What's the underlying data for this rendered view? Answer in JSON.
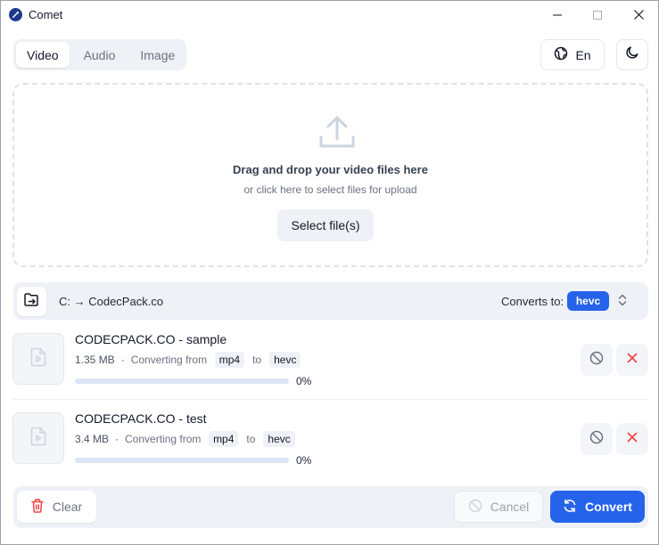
{
  "window": {
    "title": "Comet"
  },
  "tabs": [
    {
      "label": "Video",
      "active": true
    },
    {
      "label": "Audio",
      "active": false
    },
    {
      "label": "Image",
      "active": false
    }
  ],
  "language": {
    "label": "En"
  },
  "dropzone": {
    "title": "Drag and drop your video files here",
    "subtitle": "or click here to select files for upload",
    "select_label": "Select file(s)"
  },
  "output": {
    "path": "C: → CodecPack.co",
    "converts_label": "Converts to:",
    "format": "hevc"
  },
  "files": [
    {
      "name": "CODECPACK.CO - sample",
      "size": "1.35 MB",
      "status": "Converting from",
      "from": "mp4",
      "to_label": "to",
      "to": "hevc",
      "progress": 0,
      "progress_label": "0%"
    },
    {
      "name": "CODECPACK.CO - test",
      "size": "3.4 MB",
      "status": "Converting from",
      "from": "mp4",
      "to_label": "to",
      "to": "hevc",
      "progress": 0,
      "progress_label": "0%"
    }
  ],
  "footer": {
    "clear_label": "Clear",
    "cancel_label": "Cancel",
    "convert_label": "Convert"
  },
  "colors": {
    "accent": "#2563eb",
    "danger": "#ef4444",
    "surface": "#eef1f6"
  },
  "icons": {
    "app": "comet-app-icon",
    "language": "globe-icon",
    "theme": "moon-icon",
    "upload": "upload-icon",
    "folder": "folder-open-icon",
    "video_file": "video-file-icon",
    "cancel": "ban-icon",
    "remove": "x-icon",
    "clear": "trash-icon",
    "convert": "refresh-icon"
  }
}
